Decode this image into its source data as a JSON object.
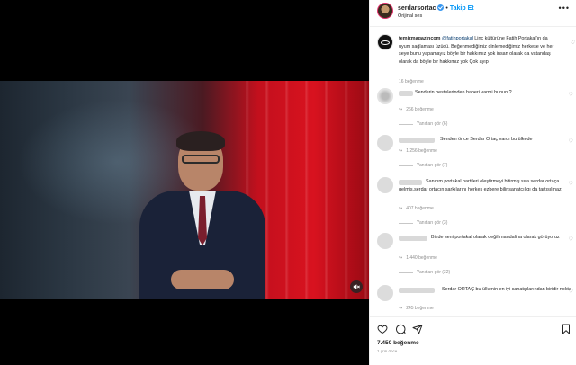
{
  "header": {
    "username": "serdarsortac",
    "separator": "•",
    "follow_label": "Takip Et",
    "audio_label": "Orijinal ses",
    "more_label": "•••"
  },
  "caption": {
    "username": "temizmagazincom",
    "mention": "@fatihportakal",
    "text": " Linç kültürüne Fatih Portakal'ın da uyum sağlaması üzücü. Beğenmediğimiz dinlemediğimiz herkese ve her şeye bunu yapamayız böyle bir hakkımız yok insan olarak da vatandaş olarak da böyle bir hakkımız yok Çok ayıp",
    "likes": "16 beğenme"
  },
  "comments": [
    {
      "text": "Senderin bestelerinden haberi varmi bunun ?",
      "likes": "266 beğenme",
      "reply_label": "Yanıtla",
      "replies": "Yanıtları gör (6)"
    },
    {
      "text": "Senden önce Serdar Ortaç vardı bu ülkede",
      "likes": "1.256 beğenme",
      "reply_label": "Yanıtla",
      "replies": "Yanıtları gör (7)"
    },
    {
      "text": "Sanırım portakal partileri eleştirmeyi bitirmiş sıra serdar ortaça gelmiş,serdar ortaçın şarkılarını herkes ezbere bilir,sanatcılıgı da tartısılmaz",
      "likes": "407 beğenme",
      "reply_label": "Yanıtla",
      "replies": "Yanıtları gör (3)"
    },
    {
      "text": "Bizde seni portakal olarak değil mandalina olarak görüyoruz",
      "likes": "1.440 beğenme",
      "reply_label": "Yanıtla",
      "replies": "Yanıtları gör (32)"
    },
    {
      "text": "Serdar ORTAÇ bu ülkenin en iyi sanatçılarından biridir nokta",
      "likes": "245 beğenme",
      "reply_label": "Yanıtla"
    }
  ],
  "footer": {
    "likes_total": "7.450 beğenme",
    "time_ago": "1 gün önce"
  },
  "colors": {
    "accent": "#0095f6",
    "verified": "#3897f0",
    "muted": "#8e8e8e",
    "text": "#262626"
  },
  "icons": [
    "heart-icon",
    "comment-icon",
    "share-icon",
    "bookmark-icon",
    "mute-icon",
    "verified-icon",
    "more-icon"
  ]
}
